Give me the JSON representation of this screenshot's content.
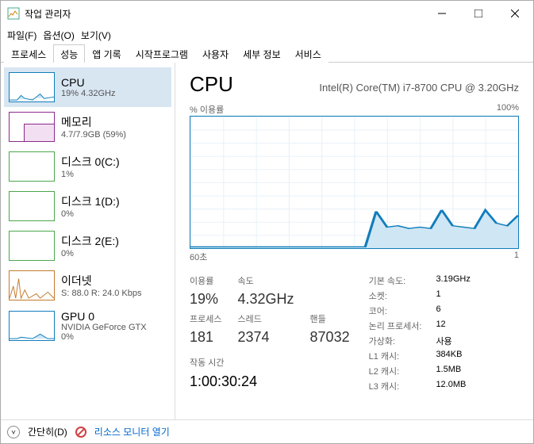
{
  "window": {
    "title": "작업 관리자"
  },
  "menu": {
    "file": "파일(F)",
    "options": "옵션(O)",
    "view": "보기(V)"
  },
  "tabs": [
    "프로세스",
    "성능",
    "앱 기록",
    "시작프로그램",
    "사용자",
    "세부 정보",
    "서비스"
  ],
  "activeTab": 1,
  "sidebar": [
    {
      "title": "CPU",
      "sub": "19% 4.32GHz",
      "color": "#117dbb",
      "selected": true
    },
    {
      "title": "메모리",
      "sub": "4.7/7.9GB (59%)",
      "color": "#8b2a8b"
    },
    {
      "title": "디스크 0(C:)",
      "sub": "1%",
      "color": "#4ca64c"
    },
    {
      "title": "디스크 1(D:)",
      "sub": "0%",
      "color": "#4ca64c"
    },
    {
      "title": "디스크 2(E:)",
      "sub": "0%",
      "color": "#4ca64c"
    },
    {
      "title": "이더넷",
      "sub": "S: 88.0 R: 24.0 Kbps",
      "color": "#c47a2c"
    },
    {
      "title": "GPU 0",
      "sub": "NVIDIA GeForce GTX",
      "sub2": "0%",
      "color": "#117dbb"
    }
  ],
  "detail": {
    "title": "CPU",
    "model": "Intel(R) Core(TM) i7-8700 CPU @ 3.20GHz",
    "chartTop": {
      "left": "% 이용률",
      "right": "100%"
    },
    "chartBottom": {
      "left": "60초",
      "right": "1"
    },
    "stats": {
      "util_lbl": "이용률",
      "util_val": "19%",
      "speed_lbl": "속도",
      "speed_val": "4.32GHz",
      "proc_lbl": "프로세스",
      "proc_val": "181",
      "thread_lbl": "스레드",
      "thread_val": "2374",
      "handle_lbl": "핸들",
      "handle_val": "87032",
      "uptime_lbl": "작동 시간",
      "uptime_val": "1:00:30:24"
    },
    "specs": {
      "base_lbl": "기본 속도:",
      "base_val": "3.19GHz",
      "sock_lbl": "소켓:",
      "sock_val": "1",
      "core_lbl": "코어:",
      "core_val": "6",
      "lproc_lbl": "논리 프로세서:",
      "lproc_val": "12",
      "virt_lbl": "가상화:",
      "virt_val": "사용",
      "l1_lbl": "L1 캐시:",
      "l1_val": "384KB",
      "l2_lbl": "L2 캐시:",
      "l2_val": "1.5MB",
      "l3_lbl": "L3 캐시:",
      "l3_val": "12.0MB"
    }
  },
  "footer": {
    "simple": "간단히(D)",
    "resmon": "리소스 모니터 열기"
  },
  "chart_data": {
    "type": "line",
    "title": "% 이용률",
    "ylabel": "",
    "xlabel": "",
    "ylim": [
      0,
      100
    ],
    "xlim_seconds": [
      60,
      0
    ],
    "x": [
      60,
      58,
      56,
      54,
      52,
      50,
      48,
      46,
      44,
      42,
      40,
      38,
      36,
      34,
      32,
      30,
      28,
      26,
      24,
      22,
      20,
      18,
      16,
      14,
      12,
      10,
      8,
      6,
      4,
      2,
      0
    ],
    "values": [
      1,
      1,
      1,
      1,
      1,
      1,
      1,
      1,
      1,
      1,
      1,
      1,
      1,
      1,
      1,
      1,
      1,
      28,
      16,
      17,
      15,
      16,
      15,
      29,
      17,
      16,
      15,
      29,
      19,
      17,
      25
    ]
  }
}
